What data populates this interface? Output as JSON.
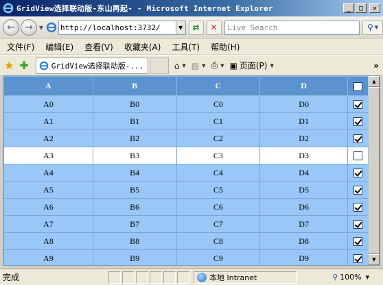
{
  "window": {
    "title": "GridView选择联动版-东山再起- - Microsoft Internet Explorer",
    "minimize_glyph": "_",
    "maximize_glyph": "□",
    "close_glyph": "✕"
  },
  "address_bar": {
    "url": "http://localhost:3732/",
    "search_placeholder": "Live Search"
  },
  "menu": [
    "文件(F)",
    "编辑(E)",
    "查看(V)",
    "收藏夹(A)",
    "工具(T)",
    "帮助(H)"
  ],
  "favorites_bar": {
    "tab_title": "GridView选择联动版-...",
    "page_label": "页面(P)"
  },
  "grid": {
    "headers": [
      "A",
      "B",
      "C",
      "D"
    ],
    "header_checked": false,
    "rows": [
      {
        "a": "A0",
        "b": "B0",
        "c": "C0",
        "d": "D0",
        "checked": true
      },
      {
        "a": "A1",
        "b": "B1",
        "c": "C1",
        "d": "D1",
        "checked": true
      },
      {
        "a": "A2",
        "b": "B2",
        "c": "C2",
        "d": "D2",
        "checked": true
      },
      {
        "a": "A3",
        "b": "B3",
        "c": "C3",
        "d": "D3",
        "checked": false
      },
      {
        "a": "A4",
        "b": "B4",
        "c": "C4",
        "d": "D4",
        "checked": true
      },
      {
        "a": "A5",
        "b": "B5",
        "c": "C5",
        "d": "D5",
        "checked": true
      },
      {
        "a": "A6",
        "b": "B6",
        "c": "C6",
        "d": "D6",
        "checked": true
      },
      {
        "a": "A7",
        "b": "B7",
        "c": "C7",
        "d": "D7",
        "checked": true
      },
      {
        "a": "A8",
        "b": "B8",
        "c": "C8",
        "d": "D8",
        "checked": true
      },
      {
        "a": "A9",
        "b": "B9",
        "c": "C9",
        "d": "D9",
        "checked": true
      }
    ],
    "selected_color": "#99c7f7",
    "header_color": "#5a93cf"
  },
  "status_bar": {
    "text": "完成",
    "zone": "本地 Intranet",
    "zoom": "100%"
  }
}
